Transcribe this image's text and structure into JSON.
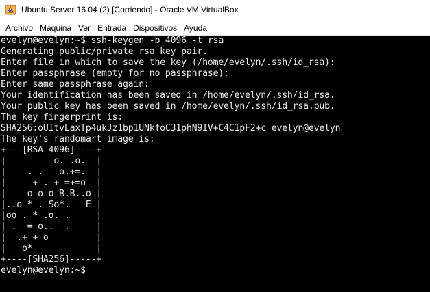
{
  "window": {
    "title": "Ubuntu Server 16.04 (2) [Corriendo] - Oracle VM VirtualBox"
  },
  "menu": {
    "items": [
      "Archivo",
      "Máquina",
      "Ver",
      "Entrada",
      "Dispositivos",
      "Ayuda"
    ]
  },
  "console": {
    "lines": [
      "evelyn@evelyn:~$ ssh-keygen -b 4096 -t rsa",
      "Generating public/private rsa key pair.",
      "Enter file in which to save the key (/home/evelyn/.ssh/id_rsa):",
      "Enter passphrase (empty for no passphrase):",
      "Enter same passphrase again:",
      "Your identification has been saved in /home/evelyn/.ssh/id_rsa.",
      "Your public key has been saved in /home/evelyn/.ssh/id_rsa.pub.",
      "The key fingerprint is:",
      "SHA256:oUItvLaxTp4ukJz1bp1UNkfoC31phN9IV+C4C1pF2+c evelyn@evelyn",
      "The key's randomart image is:",
      "+---[RSA 4096]----+",
      "|         o. .o.  |",
      "|    . .   o.+=.  |",
      "|     + . + =+=o  |",
      "|    o o o B.B..o |",
      "|..o * . So*.   E |",
      "|oo . * .o. .     |",
      "| .  = o..  .     |",
      "|  .+ + o         |",
      "|   o*            |",
      "+----[SHA256]-----+",
      "evelyn@evelyn:~$"
    ]
  },
  "colors": {
    "console_bg": "#000000",
    "console_fg": "#e8e8e8",
    "chrome_bg": "#ffffff"
  },
  "icons": {
    "app": "virtualbox-icon"
  }
}
